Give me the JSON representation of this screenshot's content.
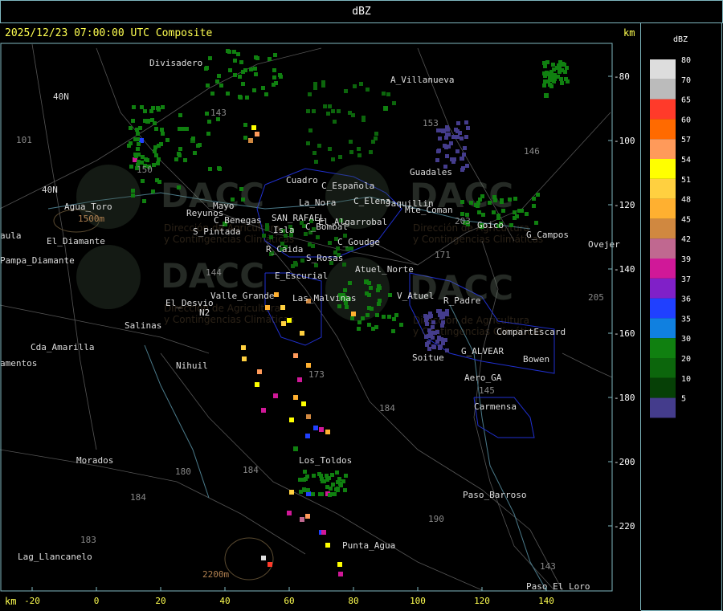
{
  "header": {
    "title": "dBZ"
  },
  "map": {
    "title": "2025/12/23 07:00:00 UTC Composite",
    "km_label_top": "km",
    "km_label_bottom": "km",
    "x_ticks": [
      "-20",
      "0",
      "20",
      "40",
      "60",
      "80",
      "100",
      "120",
      "140"
    ],
    "y_ticks": [
      "-80",
      "-100",
      "-120",
      "-140",
      "-160",
      "-180",
      "-200",
      "-220"
    ],
    "watermark": {
      "brand": "DACC",
      "line1": "Dirección de Agricultura",
      "line2": "y Contingencias Climáticas"
    },
    "places": [
      {
        "name": "Divisadero"
      },
      {
        "name": "A_Villanueva"
      },
      {
        "name": "Guadales"
      },
      {
        "name": "Agua_Toro"
      },
      {
        "name": "Goico"
      },
      {
        "name": "Ovejer"
      },
      {
        "name": "Pampa_Diamante"
      },
      {
        "name": "Cda_Amarilla"
      },
      {
        "name": "amentos"
      },
      {
        "name": "Morados"
      },
      {
        "name": "Lag_Llancanelo"
      },
      {
        "name": "Salinas"
      },
      {
        "name": "El_Desvio"
      },
      {
        "name": "Nihuil"
      },
      {
        "name": "Valle_Grande"
      },
      {
        "name": "Las_Malvinas"
      },
      {
        "name": "E_Escurial"
      },
      {
        "name": "Los_Toldos"
      },
      {
        "name": "Punta_Agua"
      },
      {
        "name": "Paso_Barroso"
      },
      {
        "name": "Paso_El_Loro"
      },
      {
        "name": "Carmensa"
      },
      {
        "name": "Aero_GA"
      },
      {
        "name": "Bowen"
      },
      {
        "name": "Soitue"
      },
      {
        "name": "G_ALVEAR"
      },
      {
        "name": "CompartEscard"
      },
      {
        "name": "R_Padre"
      },
      {
        "name": "V_Atuel"
      },
      {
        "name": "Atuel_Norte"
      },
      {
        "name": "S_Rosas"
      },
      {
        "name": "R_Caida"
      },
      {
        "name": "C_Goudge"
      },
      {
        "name": "S_Pintada"
      },
      {
        "name": "Reyunos"
      },
      {
        "name": "C_Benegas"
      },
      {
        "name": "SAN_RAFAEL"
      },
      {
        "name": "C_Bombal"
      },
      {
        "name": "El_Algarrobal"
      },
      {
        "name": "La_Nora"
      },
      {
        "name": "C_Española"
      },
      {
        "name": "C_Elena"
      },
      {
        "name": "Jaquillin"
      },
      {
        "name": "Mte_Coman"
      },
      {
        "name": "G_Campos"
      },
      {
        "name": "Isla"
      },
      {
        "name": "Cuadro"
      },
      {
        "name": "Mayo"
      },
      {
        "name": "aula"
      },
      {
        "name": "El_Diamante"
      },
      {
        "name": "1500m"
      },
      {
        "name": "2200m"
      },
      {
        "name": "101"
      },
      {
        "name": "40N"
      },
      {
        "name": "40N"
      },
      {
        "name": "143"
      },
      {
        "name": "150"
      },
      {
        "name": "153"
      },
      {
        "name": "146"
      },
      {
        "name": "203"
      },
      {
        "name": "171"
      },
      {
        "name": "205"
      },
      {
        "name": "144"
      },
      {
        "name": "173"
      },
      {
        "name": "184"
      },
      {
        "name": "180"
      },
      {
        "name": "184"
      },
      {
        "name": "184"
      },
      {
        "name": "183"
      },
      {
        "name": "190"
      },
      {
        "name": "143"
      },
      {
        "name": "145"
      },
      {
        "name": "N2"
      }
    ]
  },
  "chart_data": {
    "type": "heatmap",
    "title": "2025/12/23 07:00:00 UTC Composite",
    "xlabel": "km",
    "ylabel": "km",
    "xlim": [
      -28,
      160
    ],
    "ylim": [
      -240,
      -68
    ],
    "legend": {
      "title": "dBZ",
      "placement": "right",
      "levels": [
        {
          "value": "80",
          "color": "#dddddd"
        },
        {
          "value": "70",
          "color": "#bbbbbb"
        },
        {
          "value": "65",
          "color": "#ff3a2a"
        },
        {
          "value": "60",
          "color": "#ff6a00"
        },
        {
          "value": "57",
          "color": "#ff9a5a"
        },
        {
          "value": "54",
          "color": "#ffff00"
        },
        {
          "value": "51",
          "color": "#ffd040"
        },
        {
          "value": "48",
          "color": "#ffb030"
        },
        {
          "value": "45",
          "color": "#d08840"
        },
        {
          "value": "42",
          "color": "#c06890"
        },
        {
          "value": "39",
          "color": "#d01898"
        },
        {
          "value": "37",
          "color": "#8020c8"
        },
        {
          "value": "36",
          "color": "#2040ff"
        },
        {
          "value": "35",
          "color": "#1080e0"
        },
        {
          "value": "30",
          "color": "#108010"
        },
        {
          "value": "20",
          "color": "#0c660c"
        },
        {
          "value": "10",
          "color": "#064006"
        },
        {
          "value": "5",
          "color": "#443c8c"
        }
      ]
    },
    "cells": [
      {
        "x": 49,
        "y": -96,
        "dbz": 54
      },
      {
        "x": 50,
        "y": -98,
        "dbz": 57
      },
      {
        "x": 48,
        "y": -100,
        "dbz": 45
      },
      {
        "x": 14,
        "y": -100,
        "dbz": 36
      },
      {
        "x": 12,
        "y": -106,
        "dbz": 39
      },
      {
        "x": 16,
        "y": -94,
        "dbz": 30
      },
      {
        "x": 58,
        "y": -152,
        "dbz": 51
      },
      {
        "x": 60,
        "y": -156,
        "dbz": 54
      },
      {
        "x": 56,
        "y": -148,
        "dbz": 48
      },
      {
        "x": 66,
        "y": -150,
        "dbz": 45
      },
      {
        "x": 64,
        "y": -160,
        "dbz": 51
      },
      {
        "x": 66,
        "y": -170,
        "dbz": 48
      },
      {
        "x": 46,
        "y": -168,
        "dbz": 51
      },
      {
        "x": 50,
        "y": -176,
        "dbz": 54
      },
      {
        "x": 52,
        "y": -184,
        "dbz": 39
      },
      {
        "x": 62,
        "y": -180,
        "dbz": 48
      },
      {
        "x": 66,
        "y": -186,
        "dbz": 45
      },
      {
        "x": 70,
        "y": -190,
        "dbz": 39
      },
      {
        "x": 62,
        "y": -196,
        "dbz": 30
      },
      {
        "x": 66,
        "y": -210,
        "dbz": 36
      },
      {
        "x": 72,
        "y": -210,
        "dbz": 39
      },
      {
        "x": 60,
        "y": -216,
        "dbz": 39
      },
      {
        "x": 64,
        "y": -218,
        "dbz": 42
      },
      {
        "x": 70,
        "y": -222,
        "dbz": 36
      },
      {
        "x": 72,
        "y": -226,
        "dbz": 54
      },
      {
        "x": 52,
        "y": -230,
        "dbz": 80
      },
      {
        "x": 54,
        "y": -232,
        "dbz": 65
      },
      {
        "x": 76,
        "y": -235,
        "dbz": 39
      },
      {
        "x": 40,
        "y": -126,
        "dbz": 30
      },
      {
        "x": 90,
        "y": -90,
        "dbz": 30
      },
      {
        "x": 30,
        "y": -100,
        "dbz": 20
      },
      {
        "x": 104,
        "y": -160,
        "dbz": 5
      },
      {
        "x": 140,
        "y": -86,
        "dbz": 30
      },
      {
        "x": 80,
        "y": -154,
        "dbz": 48
      },
      {
        "x": 84,
        "y": -144,
        "dbz": 30
      }
    ]
  }
}
